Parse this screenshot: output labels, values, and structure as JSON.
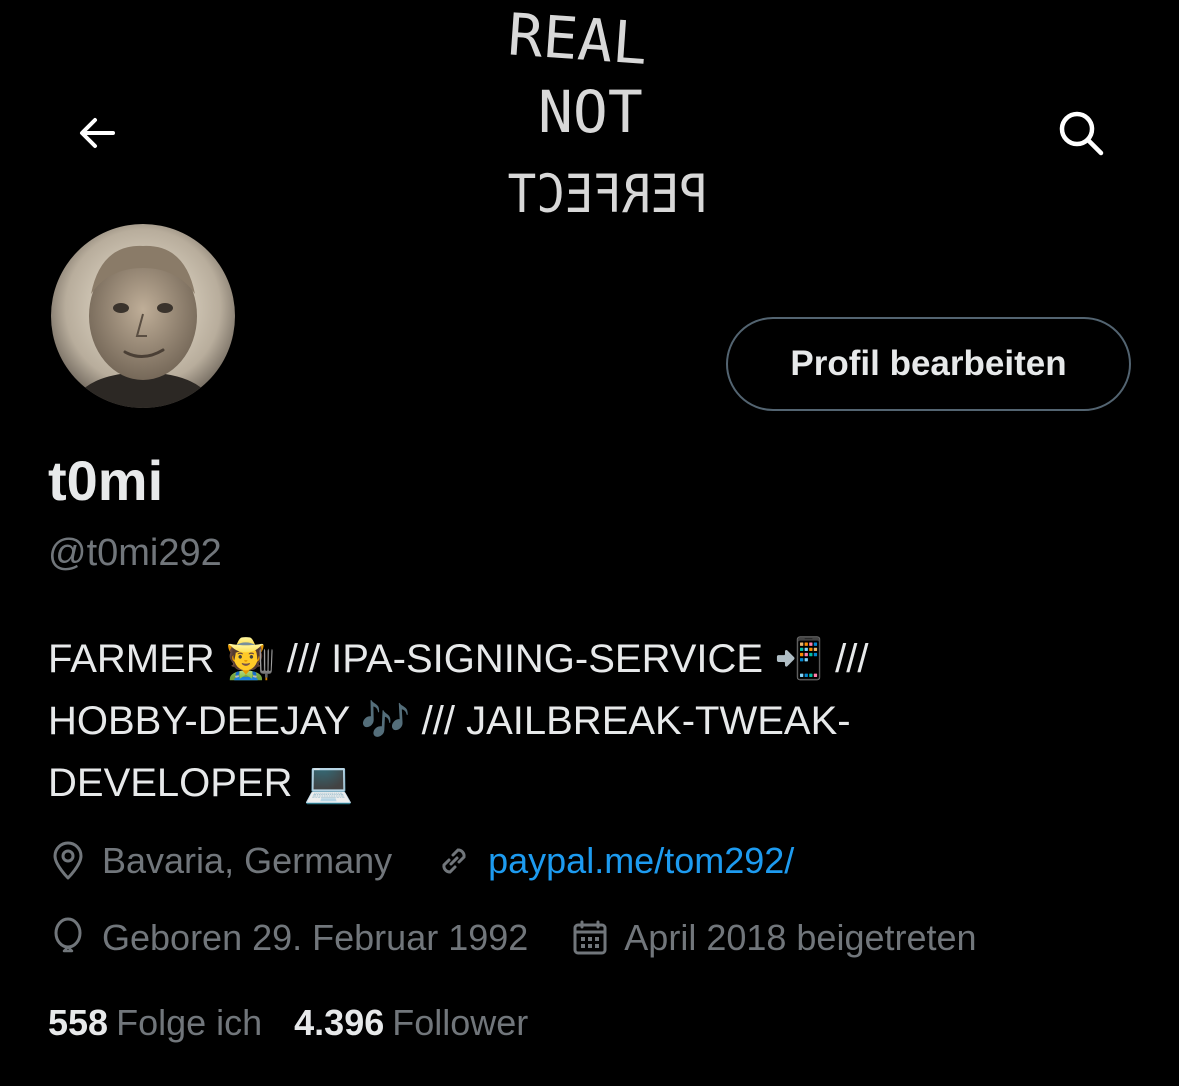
{
  "banner": {
    "line1": "REAL",
    "line2": "NOT",
    "line3": "PERFECT"
  },
  "nav": {
    "back_icon": "arrow-left-icon",
    "search_icon": "search-icon"
  },
  "profile": {
    "edit_label": "Profil bearbeiten",
    "name": "t0mi",
    "handle": "@t0mi292",
    "bio_lines": [
      "FARMER 🧑‍🌾 /// IPA-SIGNING-SERVICE 📲 ///",
      "HOBBY-DEEJAY 🎶 /// JAILBREAK-TWEAK-",
      "DEVELOPER 💻"
    ],
    "location": "Bavaria, Germany",
    "website": "paypal.me/tom292/",
    "birthday": "Geboren 29. Februar 1992",
    "joined": "April 2018 beigetreten"
  },
  "stats": {
    "following_count": "558",
    "following_label": "Folge ich",
    "followers_count": "4.396",
    "followers_label": "Follower"
  },
  "colors": {
    "background": "#000000",
    "text_primary": "#e7e9ea",
    "text_secondary": "#71767b",
    "link": "#1d9bf0",
    "border": "#536471"
  }
}
